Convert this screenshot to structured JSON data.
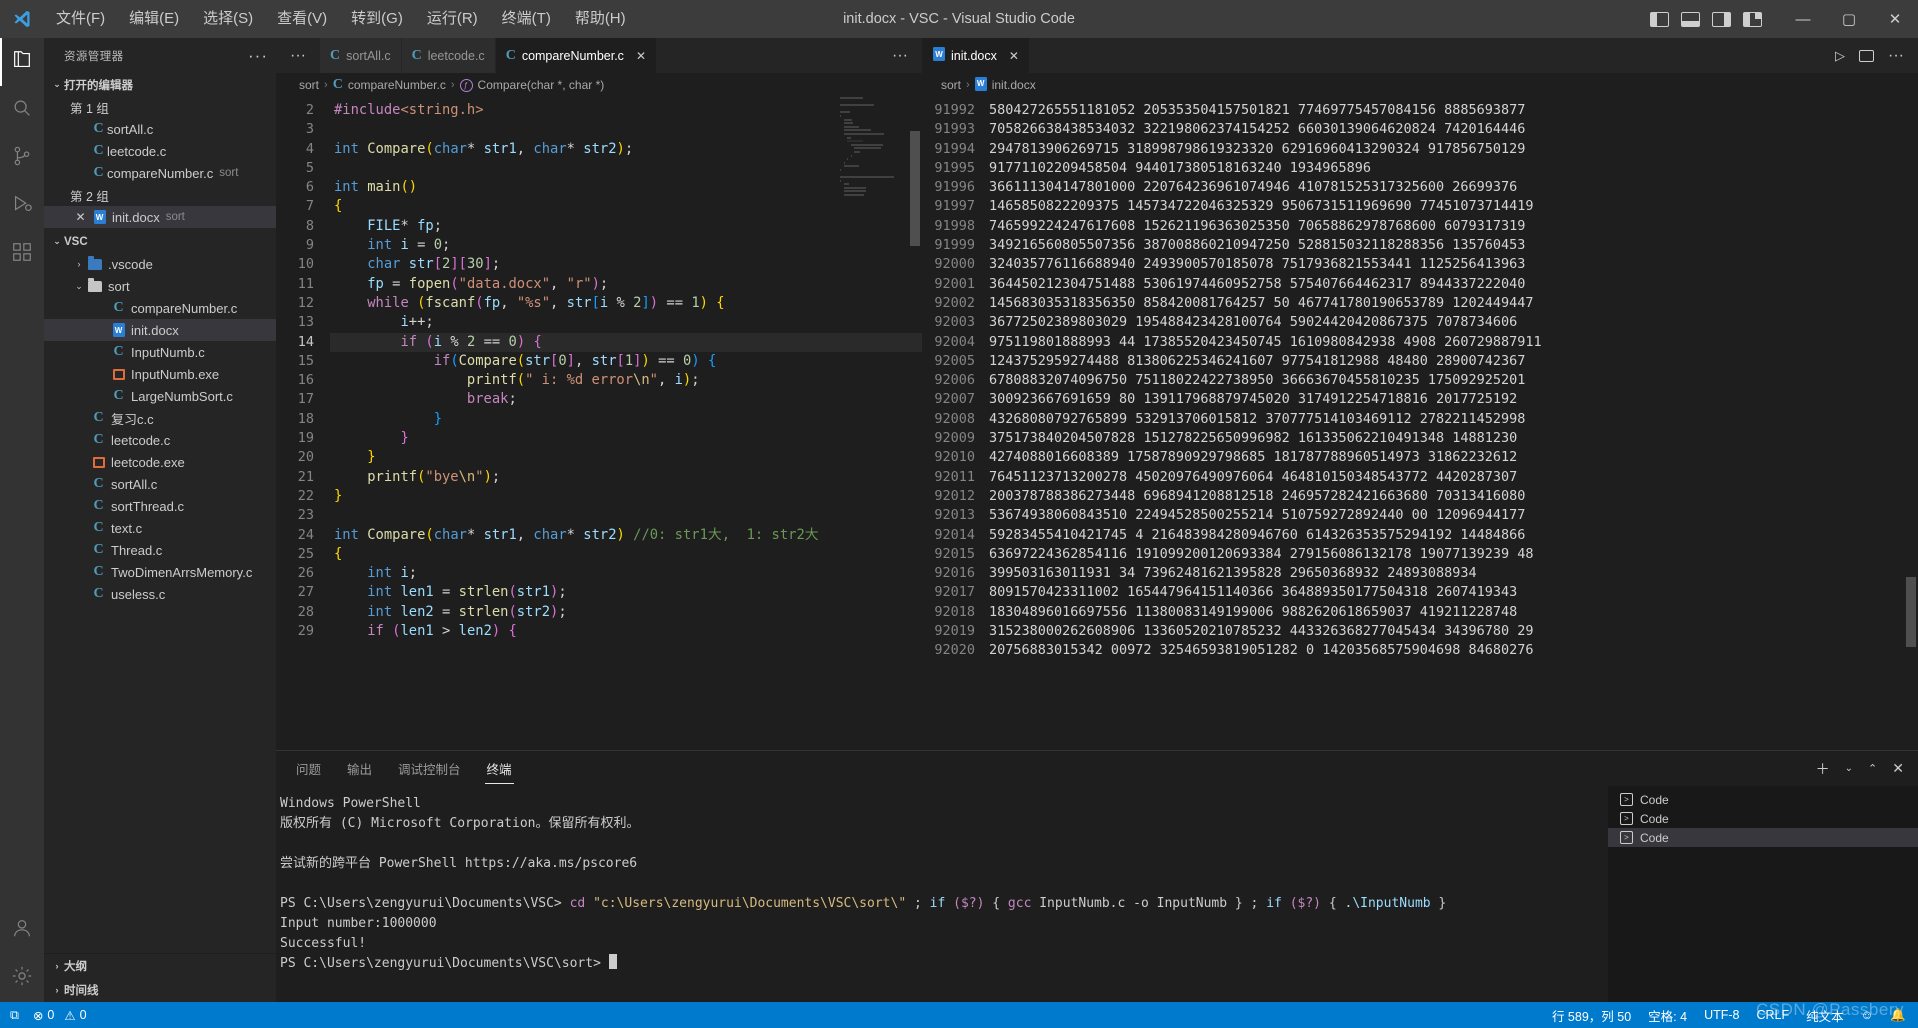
{
  "titlebar": {
    "logo_icon": "vscode-logo-icon",
    "menus": [
      "文件(F)",
      "编辑(E)",
      "选择(S)",
      "查看(V)",
      "转到(G)",
      "运行(R)",
      "终端(T)",
      "帮助(H)"
    ],
    "title": "init.docx - VSC - Visual Studio Code",
    "layout_icons": [
      "panel-left-icon",
      "panel-bottom-icon",
      "panel-right-icon",
      "editor-layout-icon"
    ],
    "window_buttons": {
      "minimize": "—",
      "maximize": "▢",
      "close": "✕"
    }
  },
  "activitybar": {
    "items": [
      {
        "name": "explorer",
        "icon": "files-icon",
        "active": true
      },
      {
        "name": "search",
        "icon": "search-icon",
        "active": false
      },
      {
        "name": "source-control",
        "icon": "source-control-icon",
        "active": false
      },
      {
        "name": "run-and-debug",
        "icon": "run-debug-icon",
        "active": false
      },
      {
        "name": "extensions",
        "icon": "extensions-icon",
        "active": false
      }
    ],
    "bottom": [
      {
        "name": "accounts",
        "icon": "account-icon"
      },
      {
        "name": "settings",
        "icon": "gear-icon"
      }
    ]
  },
  "sidebar": {
    "header_title": "资源管理器",
    "more_icon": "more-actions-icon",
    "open_editors": {
      "label": "打开的编辑器",
      "groups": [
        {
          "label": "第 1 组",
          "items": [
            {
              "name": "sortAll.c",
              "desc": "",
              "icon": "c-file-icon",
              "selected": false,
              "close": false
            },
            {
              "name": "leetcode.c",
              "desc": "",
              "icon": "c-file-icon",
              "selected": false,
              "close": false
            },
            {
              "name": "compareNumber.c",
              "desc": "sort",
              "icon": "c-file-icon",
              "selected": false,
              "close": false
            }
          ]
        },
        {
          "label": "第 2 组",
          "items": [
            {
              "name": "init.docx",
              "desc": "sort",
              "icon": "docx-file-icon",
              "selected": true,
              "close": true
            }
          ]
        }
      ]
    },
    "workspace": {
      "label": "VSC",
      "tree": [
        {
          "name": ".vscode",
          "type": "folder",
          "icon": "vscode-folder-icon",
          "depth": 1,
          "expanded": false,
          "selected": false
        },
        {
          "name": "sort",
          "type": "folder",
          "icon": "folder-icon",
          "depth": 1,
          "expanded": true,
          "selected": false
        },
        {
          "name": "compareNumber.c",
          "type": "c",
          "icon": "c-file-icon",
          "depth": 2,
          "selected": false
        },
        {
          "name": "init.docx",
          "type": "docx",
          "icon": "docx-file-icon",
          "depth": 2,
          "selected": true
        },
        {
          "name": "InputNumb.c",
          "type": "c",
          "icon": "c-file-icon",
          "depth": 2,
          "selected": false
        },
        {
          "name": "InputNumb.exe",
          "type": "exe",
          "icon": "exe-file-icon",
          "depth": 2,
          "selected": false
        },
        {
          "name": "LargeNumbSort.c",
          "type": "c",
          "icon": "c-file-icon",
          "depth": 2,
          "selected": false
        },
        {
          "name": "复习c.c",
          "type": "c",
          "icon": "c-file-icon",
          "depth": 1,
          "selected": false
        },
        {
          "name": "leetcode.c",
          "type": "c",
          "icon": "c-file-icon",
          "depth": 1,
          "selected": false
        },
        {
          "name": "leetcode.exe",
          "type": "exe",
          "icon": "exe-file-icon",
          "depth": 1,
          "selected": false
        },
        {
          "name": "sortAll.c",
          "type": "c",
          "icon": "c-file-icon",
          "depth": 1,
          "selected": false
        },
        {
          "name": "sortThread.c",
          "type": "c",
          "icon": "c-file-icon",
          "depth": 1,
          "selected": false
        },
        {
          "name": "text.c",
          "type": "c",
          "icon": "c-file-icon",
          "depth": 1,
          "selected": false
        },
        {
          "name": "Thread.c",
          "type": "c",
          "icon": "c-file-icon",
          "depth": 1,
          "selected": false
        },
        {
          "name": "TwoDimenArrsMemory.c",
          "type": "c",
          "icon": "c-file-icon",
          "depth": 1,
          "selected": false
        },
        {
          "name": "useless.c",
          "type": "c",
          "icon": "c-file-icon",
          "depth": 1,
          "selected": false
        }
      ]
    },
    "bottom_sections": [
      "大纲",
      "时间线"
    ]
  },
  "editor_group_1": {
    "tabs": [
      {
        "label": "sortAll.c",
        "icon": "c-file-icon",
        "active": false,
        "close": false
      },
      {
        "label": "leetcode.c",
        "icon": "c-file-icon",
        "active": false,
        "close": false
      },
      {
        "label": "compareNumber.c",
        "icon": "c-file-icon",
        "active": true,
        "close": true
      }
    ],
    "more_icon": "more-actions-icon",
    "breadcrumb": [
      "sort",
      "compareNumber.c",
      "Compare(char *, char *)"
    ],
    "first_line_number": 2,
    "current_line": 14,
    "lines": [
      {
        "n": 2,
        "html": "<span class='pre'>#include</span><span class='inc'>&lt;string.h&gt;</span>"
      },
      {
        "n": 3,
        "html": ""
      },
      {
        "n": 4,
        "html": "<span class='k'>int</span> <span class='fn'>Compare</span><span class='p1'>(</span><span class='k'>char</span><span class='op'>*</span> <span class='var'>str1</span><span class='op'>,</span> <span class='k'>char</span><span class='op'>*</span> <span class='var'>str2</span><span class='p1'>)</span><span class='op'>;</span>"
      },
      {
        "n": 5,
        "html": ""
      },
      {
        "n": 6,
        "html": "<span class='k'>int</span> <span class='fn'>main</span><span class='p1'>()</span>"
      },
      {
        "n": 7,
        "html": "<span class='p1'>{</span>"
      },
      {
        "n": 8,
        "html": "    <span class='var'>FILE</span><span class='op'>*</span> <span class='var'>fp</span><span class='op'>;</span>"
      },
      {
        "n": 9,
        "html": "    <span class='k'>int</span> <span class='var'>i</span> <span class='op'>=</span> <span class='num'>0</span><span class='op'>;</span>"
      },
      {
        "n": 10,
        "html": "    <span class='k'>char</span> <span class='var'>str</span><span class='p2'>[</span><span class='num'>2</span><span class='p2'>]</span><span class='p2'>[</span><span class='num'>30</span><span class='p2'>]</span><span class='op'>;</span>"
      },
      {
        "n": 11,
        "html": "    <span class='var'>fp</span> <span class='op'>=</span> <span class='fn'>fopen</span><span class='p2'>(</span><span class='str'>\"data.docx\"</span><span class='op'>,</span> <span class='str'>\"r\"</span><span class='p2'>)</span><span class='op'>;</span>"
      },
      {
        "n": 12,
        "html": "    <span class='kctl'>while</span> <span class='p1'>(</span><span class='fn'>fscanf</span><span class='p2'>(</span><span class='var'>fp</span><span class='op'>,</span> <span class='str'>\"%s\"</span><span class='op'>,</span> <span class='var'>str</span><span class='p3'>[</span><span class='var'>i</span> <span class='op'>%</span> <span class='num'>2</span><span class='p3'>]</span><span class='p2'>)</span> <span class='op'>==</span> <span class='num'>1</span><span class='p1'>)</span> <span class='p1'>{</span>"
      },
      {
        "n": 13,
        "html": "        <span class='var'>i</span><span class='op'>++;</span>"
      },
      {
        "n": 14,
        "html": "        <span class='kctl'>if</span> <span class='p2'>(</span><span class='var'>i</span> <span class='op'>%</span> <span class='num'>2</span> <span class='op'>==</span> <span class='num'>0</span><span class='p2'>)</span> <span class='p2'>{</span>",
        "highlight": true
      },
      {
        "n": 15,
        "html": "            <span class='kctl'>if</span><span class='p3'>(</span><span class='fn'>Compare</span><span class='p1'>(</span><span class='var'>str</span><span class='p2'>[</span><span class='num'>0</span><span class='p2'>]</span><span class='op'>,</span> <span class='var'>str</span><span class='p2'>[</span><span class='num'>1</span><span class='p2'>]</span><span class='p1'>)</span> <span class='op'>==</span> <span class='num'>0</span><span class='p3'>)</span> <span class='p3'>{</span>"
      },
      {
        "n": 16,
        "html": "                <span class='fn'>printf</span><span class='p1'>(</span><span class='str'>\" i: %d error</span><span class='esc'>\\n</span><span class='str'>\"</span><span class='op'>,</span> <span class='var'>i</span><span class='p1'>)</span><span class='op'>;</span>"
      },
      {
        "n": 17,
        "html": "                <span class='kctl'>break</span><span class='op'>;</span>"
      },
      {
        "n": 18,
        "html": "            <span class='p3'>}</span>"
      },
      {
        "n": 19,
        "html": "        <span class='p2'>}</span>"
      },
      {
        "n": 20,
        "html": "    <span class='p1'>}</span>"
      },
      {
        "n": 21,
        "html": "    <span class='fn'>printf</span><span class='p1'>(</span><span class='str'>\"bye</span><span class='esc'>\\n</span><span class='str'>\"</span><span class='p1'>)</span><span class='op'>;</span>"
      },
      {
        "n": 22,
        "html": "<span class='p1'>}</span>"
      },
      {
        "n": 23,
        "html": ""
      },
      {
        "n": 24,
        "html": "<span class='k'>int</span> <span class='fn'>Compare</span><span class='p1'>(</span><span class='k'>char</span><span class='op'>*</span> <span class='var'>str1</span><span class='op'>,</span> <span class='k'>char</span><span class='op'>*</span> <span class='var'>str2</span><span class='p1'>)</span> <span class='cmt'>//0: str1大,  1: str2大</span>"
      },
      {
        "n": 25,
        "html": "<span class='p1'>{</span>"
      },
      {
        "n": 26,
        "html": "    <span class='k'>int</span> <span class='var'>i</span><span class='op'>;</span>"
      },
      {
        "n": 27,
        "html": "    <span class='k'>int</span> <span class='var'>len1</span> <span class='op'>=</span> <span class='fn'>strlen</span><span class='p2'>(</span><span class='var'>str1</span><span class='p2'>)</span><span class='op'>;</span>"
      },
      {
        "n": 28,
        "html": "    <span class='k'>int</span> <span class='var'>len2</span> <span class='op'>=</span> <span class='fn'>strlen</span><span class='p2'>(</span><span class='var'>str2</span><span class='p2'>)</span><span class='op'>;</span>"
      },
      {
        "n": 29,
        "html": "    <span class='kctl'>if</span> <span class='p2'>(</span><span class='var'>len1</span> <span class='op'>&gt;</span> <span class='var'>len2</span><span class='p2'>)</span> <span class='p2'>{</span>"
      }
    ]
  },
  "editor_group_2": {
    "tabs": [
      {
        "label": "init.docx",
        "icon": "docx-file-icon",
        "active": true,
        "close": true
      }
    ],
    "actions": [
      "run-icon",
      "split-editor-icon",
      "more-actions-icon"
    ],
    "breadcrumb": [
      "sort",
      "init.docx"
    ],
    "lines": [
      {
        "n": 91992,
        "text": "580427265551181052 205353504157501821 77469775457084156 8885693877"
      },
      {
        "n": 91993,
        "text": "705826638438534032 322198062374154252 66030139064620824 7420164446"
      },
      {
        "n": 91994,
        "text": "2947813906269715 318998798619323320 62916960413290324 917856750129"
      },
      {
        "n": 91995,
        "text": "91771102209458504 944017380518163240 1934965896"
      },
      {
        "n": 91996,
        "text": "366111304147801000 220764236961074946 410781525317325600 26699376"
      },
      {
        "n": 91997,
        "text": "1465850822209375 145734722046325329 9506731511969690 77451073714419"
      },
      {
        "n": 91998,
        "text": "746599224247617608 152621196363025350 70658862978768600 6079317319"
      },
      {
        "n": 91999,
        "text": "349216560805507356 387008860210947250 528815032118288356 135760453"
      },
      {
        "n": 92000,
        "text": "324035776116688940 2493900570185078 7517936821553441 1125256413963"
      },
      {
        "n": 92001,
        "text": "364450212304751488 53061974460952758 575407664462317 8944337222040"
      },
      {
        "n": 92002,
        "text": "145683035318356350 858420081764257 50 467741780190653789 1202449447"
      },
      {
        "n": 92003,
        "text": "36772502389803029 195488423428100764 59024420420867375 7078734606"
      },
      {
        "n": 92004,
        "text": "975119801888993 44 17385520423450745 1610980842938 4908 260729887911"
      },
      {
        "n": 92005,
        "text": "1243752959274488 813806225346241607 977541812988 48480 28900742367"
      },
      {
        "n": 92006,
        "text": "67808832074096750 75118022422738950 36663670455810235 175092925201"
      },
      {
        "n": 92007,
        "text": "300923667691659 80 139117968879745020 3174912254718816 2017725192"
      },
      {
        "n": 92008,
        "text": "43268080792765899 532913706015812 370777514103469112 2782211452998"
      },
      {
        "n": 92009,
        "text": "375173840204507828 151278225650996982 161335062210491348 14881230"
      },
      {
        "n": 92010,
        "text": "4274088016608389 17587890929798685 181787788960514973 31862232612"
      },
      {
        "n": 92011,
        "text": "76451123713200278 45020976490976064 464810150348543772 4420287307"
      },
      {
        "n": 92012,
        "text": "200378788386273448 6968941208812518 246957282421663680 70313416080"
      },
      {
        "n": 92013,
        "text": "53674938060843510 22494528500255214 510759272892440 00 12096944177"
      },
      {
        "n": 92014,
        "text": "59283455410421745 4 216483984280946760 614326353575294192 14484866"
      },
      {
        "n": 92015,
        "text": "63697224362854116 191099200120693384 279156086132178 19077139239 48"
      },
      {
        "n": 92016,
        "text": "399503163011931 34 73962481621395828 29650368932 24893088934"
      },
      {
        "n": 92017,
        "text": "8091570423311002 165447964151140366 364889350177504318 2607419343"
      },
      {
        "n": 92018,
        "text": "18304896016697556 11380083149199006 9882620618659037 419211228748"
      },
      {
        "n": 92019,
        "text": "315238000262608906 13360520210785232 443326368277045434 34396780 29"
      },
      {
        "n": 92020,
        "text": "20756883015342 00972 32546593819051282 0 14203568575904698 84680276"
      }
    ]
  },
  "panel": {
    "tabs": [
      "问题",
      "输出",
      "调试控制台",
      "终端"
    ],
    "active_tab": "终端",
    "actions": [
      "add-terminal-icon",
      "split-terminal-icon",
      "chevron-up-icon",
      "close-panel-icon"
    ],
    "terminal_lines": [
      "Windows PowerShell",
      "版权所有 (C) Microsoft Corporation。保留所有权利。",
      "",
      "尝试新的跨平台 PowerShell https://aka.ms/pscore6",
      "",
      "PS C:\\Users\\zengyurui\\Documents\\VSC> cd \"c:\\Users\\zengyurui\\Documents\\VSC\\sort\\\" ; if ($?) { gcc InputNumb.c -o InputNumb } ; if ($?) { .\\InputNumb }",
      "Input number:1000000",
      "Successful!",
      "PS C:\\Users\\zengyurui\\Documents\\VSC\\sort>"
    ],
    "terminal_prompt_path": "PS C:\\Users\\zengyurui\\Documents\\VSC>",
    "terminal_prompt_path2": "PS C:\\Users\\zengyurui\\Documents\\VSC\\sort>",
    "command": "cd \"c:\\Users\\zengyurui\\Documents\\VSC\\sort\\\" ; if ($?) { gcc InputNumb.c -o InputNumb } ; if ($?) { .\\InputNumb }",
    "output_lines": [
      "Input number:1000000",
      "Successful!"
    ],
    "terminal_list": [
      {
        "label": "Code",
        "icon": "terminal-icon",
        "selected": false
      },
      {
        "label": "Code",
        "icon": "terminal-icon",
        "selected": false
      },
      {
        "label": "Code",
        "icon": "terminal-icon",
        "selected": true
      }
    ]
  },
  "statusbar": {
    "remote_icon": "remote-icon",
    "errors": "0",
    "warnings": "0",
    "error_icon": "error-icon",
    "warning_icon": "warning-icon",
    "position": "行 589，列 50",
    "indent": "空格: 4",
    "encoding": "UTF-8",
    "eol": "CRLF",
    "language": "纯文本",
    "feedback_icon": "smiley-icon",
    "bell_icon": "bell-icon",
    "watermark": "CSDN @Passbery"
  },
  "colors": {
    "accent": "#007acc",
    "titlebar_bg": "#3c3c3c",
    "sidebar_bg": "#252526",
    "editor_bg": "#1e1e1e",
    "activitybar_bg": "#333333",
    "selection_bg": "#37373d"
  }
}
